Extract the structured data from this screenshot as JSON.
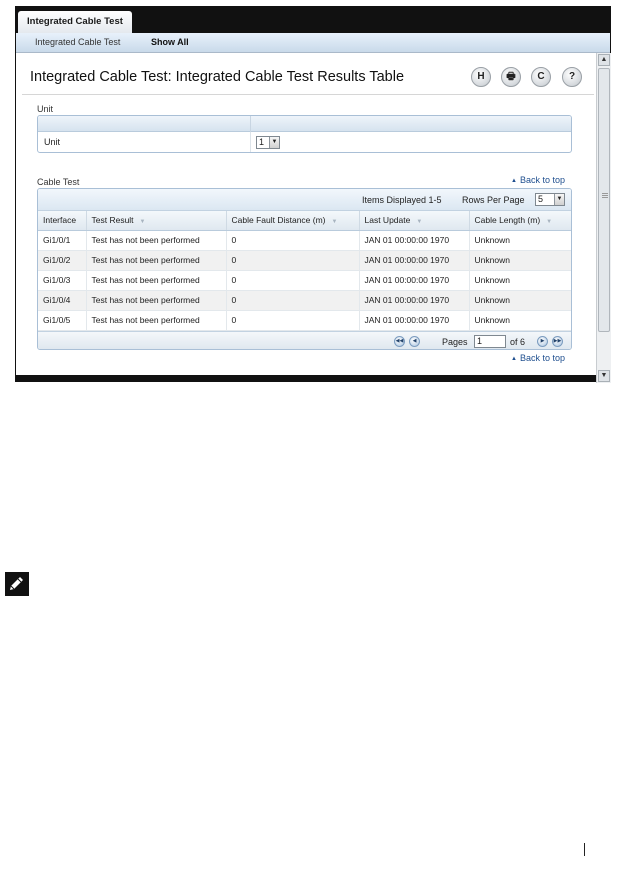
{
  "tabs": {
    "active": "Integrated Cable Test"
  },
  "subnav": {
    "items": [
      "Integrated Cable Test",
      "Show All"
    ]
  },
  "page": {
    "title": "Integrated Cable Test: Integrated Cable Test Results Table"
  },
  "toolbar": {
    "save": "H",
    "print": "🖶",
    "refresh": "C",
    "help": "?"
  },
  "unit_section": {
    "label": "Unit",
    "row_label": "Unit",
    "selected": "1"
  },
  "cable_section": {
    "label": "Cable Test",
    "back_to_top": "Back to top",
    "items_displayed": "Items Displayed 1-5",
    "rows_per_page_label": "Rows Per Page",
    "rows_per_page": "5",
    "columns": [
      "Interface",
      "Test Result",
      "Cable Fault Distance (m)",
      "Last Update",
      "Cable Length (m)"
    ],
    "rows": [
      [
        "Gi1/0/1",
        "Test has not been performed",
        "0",
        "JAN 01 00:00:00 1970",
        "Unknown"
      ],
      [
        "Gi1/0/2",
        "Test has not been performed",
        "0",
        "JAN 01 00:00:00 1970",
        "Unknown"
      ],
      [
        "Gi1/0/3",
        "Test has not been performed",
        "0",
        "JAN 01 00:00:00 1970",
        "Unknown"
      ],
      [
        "Gi1/0/4",
        "Test has not been performed",
        "0",
        "JAN 01 00:00:00 1970",
        "Unknown"
      ],
      [
        "Gi1/0/5",
        "Test has not been performed",
        "0",
        "JAN 01 00:00:00 1970",
        "Unknown"
      ]
    ],
    "pager": {
      "pages_label": "Pages",
      "current_page": "1",
      "of_label": "of 6"
    },
    "back_to_top_bottom": "Back to top"
  }
}
